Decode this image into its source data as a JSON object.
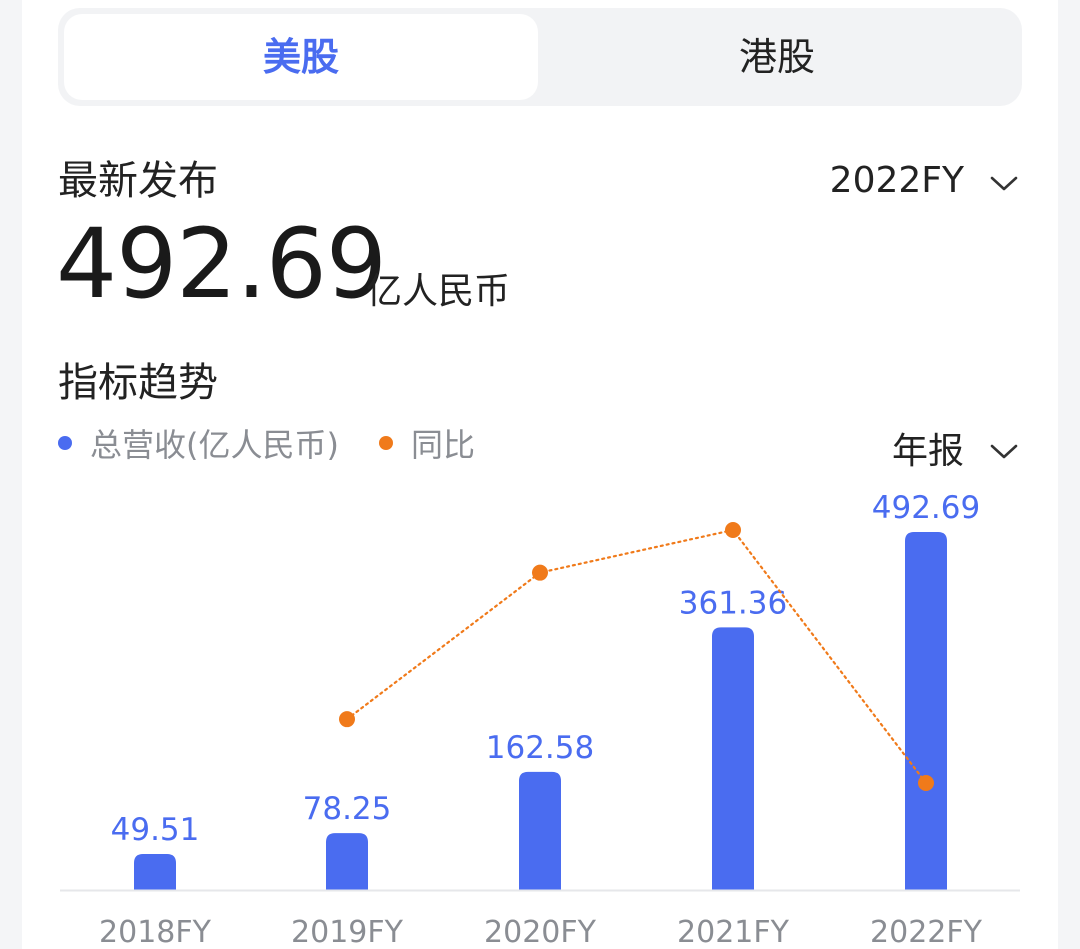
{
  "tabs": [
    {
      "label": "美股",
      "active": true
    },
    {
      "label": "港股",
      "active": false
    }
  ],
  "latest": {
    "title": "最新发布",
    "period_select": "2022FY",
    "value": "492.69",
    "unit": "亿人民币"
  },
  "trend": {
    "title": "指标趋势",
    "report_select": "年报",
    "legend": [
      {
        "label": "总营收(亿人民币)",
        "color": "#4a6cf0"
      },
      {
        "label": "同比",
        "color": "#f07a1a"
      }
    ]
  },
  "colors": {
    "accent": "#4a6cf0",
    "yoy": "#f07a1a"
  },
  "chart_data": {
    "type": "bar",
    "categories": [
      "2018FY",
      "2019FY",
      "2020FY",
      "2021FY",
      "2022FY"
    ],
    "series": [
      {
        "name": "总营收(亿人民币)",
        "type": "bar",
        "values": [
          49.51,
          78.25,
          162.58,
          361.36,
          492.69
        ]
      },
      {
        "name": "同比",
        "type": "line",
        "values": [
          null,
          58.0,
          107.8,
          122.3,
          36.3
        ]
      }
    ],
    "data_labels": [
      "49.51",
      "78.25",
      "162.58",
      "361.36",
      "492.69"
    ],
    "ylim": [
      0,
      492.69
    ],
    "yoy_ylim": [
      0,
      122.3
    ],
    "grid": false,
    "legend_position": "top-left"
  }
}
